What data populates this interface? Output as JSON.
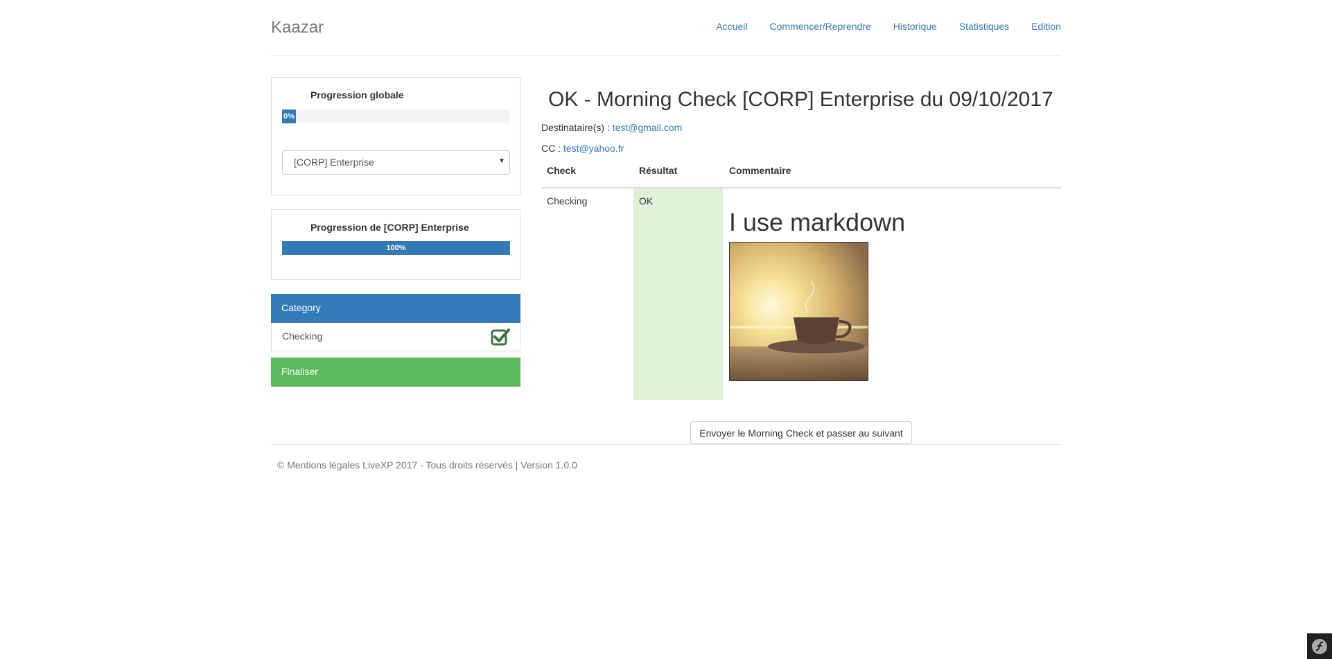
{
  "header": {
    "brand": "Kaazar",
    "nav": [
      "Accueil",
      "Commencer/Reprendre",
      "Historique",
      "Statistiques",
      "Edition"
    ]
  },
  "sidebar": {
    "global_progress": {
      "title": "Progression globale",
      "label": "0%",
      "fraction": 0.0
    },
    "environment_select": {
      "value": "[CORP] Enterprise"
    },
    "env_progress": {
      "title": "Progression de [CORP] Enterprise",
      "label": "100%",
      "fraction": 1.0
    },
    "category_header": "Category",
    "categories": [
      {
        "label": "Checking",
        "done": true
      }
    ],
    "finalize_label": "Finaliser"
  },
  "main": {
    "title": "OK - Morning Check [CORP] Enterprise du 09/10/2017",
    "recipients_label": "Destinataire(s) :",
    "recipients": "test@gmail.com",
    "cc_label": "CC :",
    "cc": "test@yahoo.fr",
    "table": {
      "headers": [
        "Check",
        "Résultat",
        "Commentaire"
      ],
      "rows": [
        {
          "check": "Checking",
          "result": "OK",
          "comment_heading": "I use markdown"
        }
      ]
    },
    "send_button": "Envoyer le Morning Check et passer au suivant"
  },
  "footer": {
    "text": "© Mentions légales LiveXP 2017 - Tous droits réservés | Version 1.0.0"
  },
  "colors": {
    "primary": "#337ab7",
    "success": "#5cb85c",
    "result_ok_bg": "#dff0d8"
  },
  "icons": {
    "category_done": "check-square-icon",
    "toolbar": "symfony-icon"
  }
}
